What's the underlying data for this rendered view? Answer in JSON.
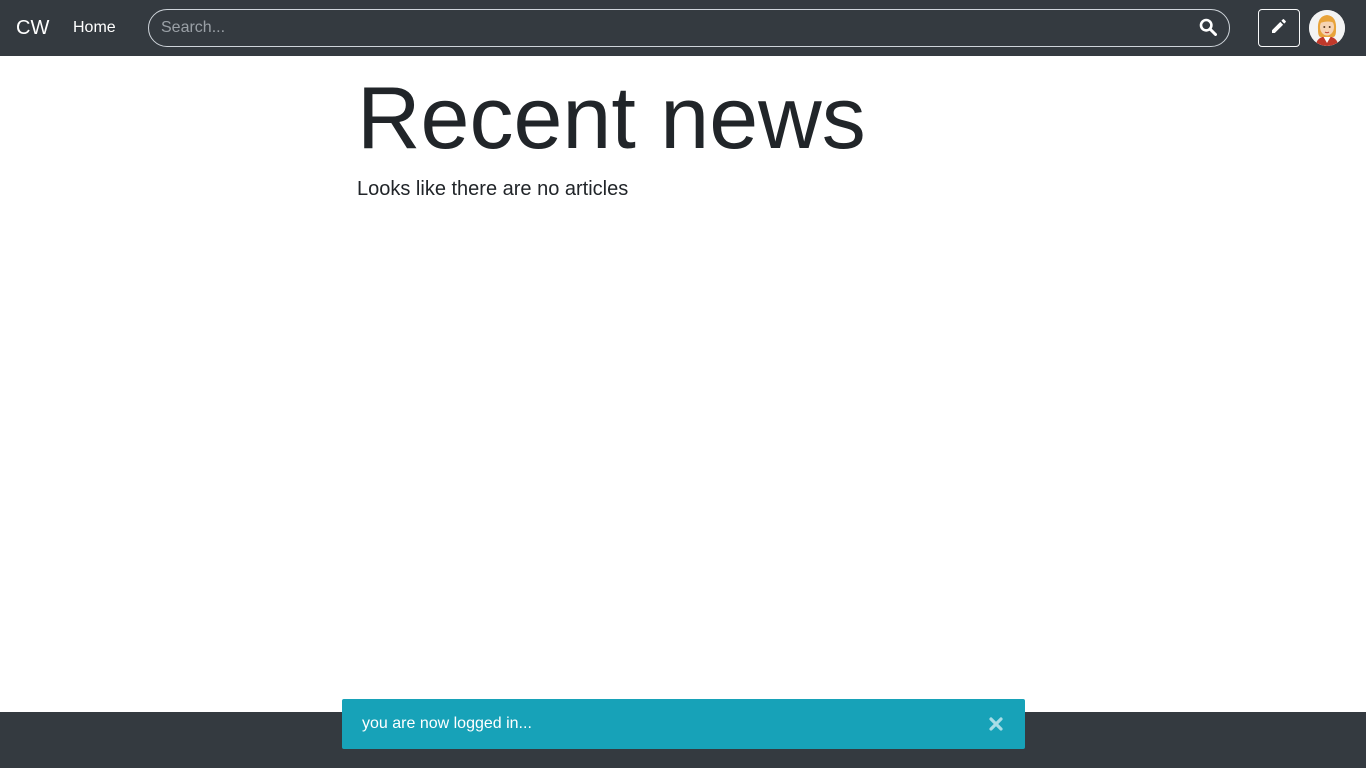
{
  "nav": {
    "brand": "CW",
    "home_label": "Home"
  },
  "search": {
    "placeholder": "Search...",
    "value": ""
  },
  "main": {
    "title": "Recent news",
    "empty_message": "Looks like there are no articles"
  },
  "toast": {
    "message": "you are now logged in..."
  },
  "icons": {
    "search": "search-icon",
    "write": "pencil-icon",
    "avatar": "user-avatar",
    "close": "close-icon"
  },
  "colors": {
    "navbar": "#343a40",
    "toast": "#17a2b8",
    "text": "#212529"
  }
}
